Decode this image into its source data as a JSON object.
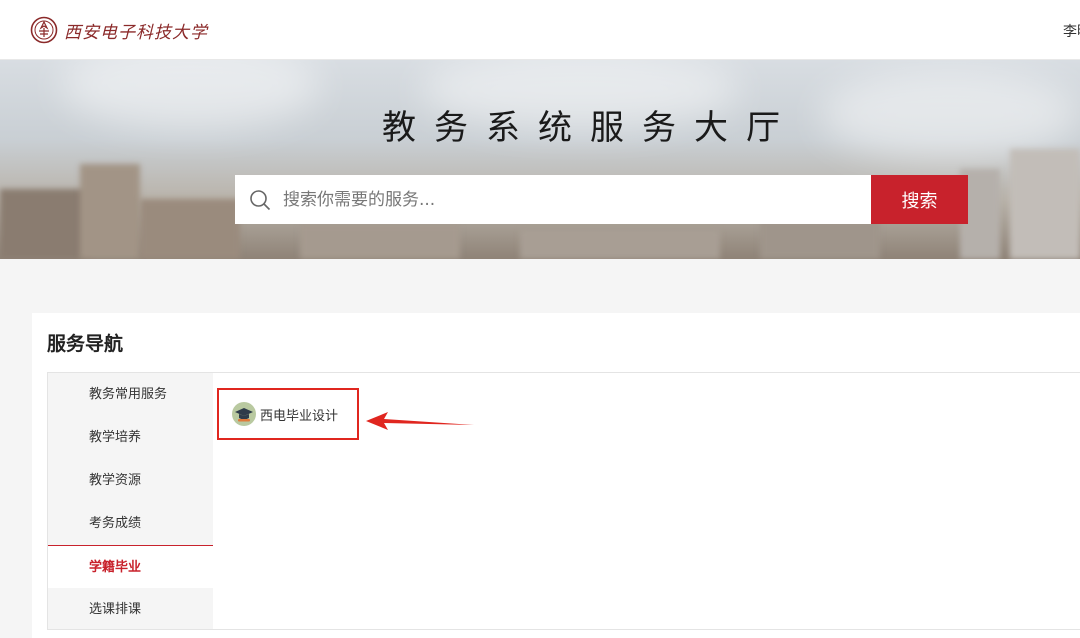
{
  "header": {
    "logo_text": "西安电子科技大学",
    "user_name": "李明"
  },
  "banner": {
    "title": "教务系统服务大厅"
  },
  "search": {
    "placeholder": "搜索你需要的服务...",
    "button_label": "搜索"
  },
  "service_nav": {
    "title": "服务导航",
    "categories": [
      {
        "label": "教务常用服务",
        "active": false
      },
      {
        "label": "教学培养",
        "active": false
      },
      {
        "label": "教学资源",
        "active": false
      },
      {
        "label": "考务成绩",
        "active": false
      },
      {
        "label": "学籍毕业",
        "active": true
      },
      {
        "label": "选课排课",
        "active": false
      }
    ],
    "apps": [
      {
        "label": "西电毕业设计",
        "icon": "graduation-cap-icon"
      }
    ]
  },
  "colors": {
    "accent": "#c8222c",
    "highlight_box": "#e0261f"
  }
}
